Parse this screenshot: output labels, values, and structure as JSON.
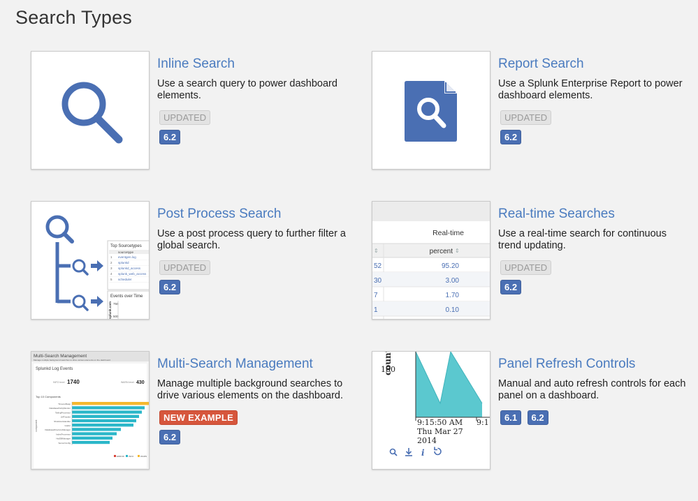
{
  "page": {
    "title": "Search Types"
  },
  "colors": {
    "accent": "#4a7bbf",
    "version_badge": "#4a6fb3",
    "new_badge": "#d6563c",
    "chart_fill": "#5bc8cf"
  },
  "cards": [
    {
      "title": "Inline Search",
      "description": "Use a search query to power dashboard elements.",
      "status_badge": "UPDATED",
      "versions": [
        "6.2"
      ],
      "thumbnail_icon": "magnifier-icon"
    },
    {
      "title": "Report Search",
      "description": "Use a Splunk Enterprise Report to power dashboard elements.",
      "status_badge": "UPDATED",
      "versions": [
        "6.2"
      ],
      "thumbnail_icon": "report-document-icon"
    },
    {
      "title": "Post Process Search",
      "description": "Use a post process query to further filter a global search.",
      "status_badge": "UPDATED",
      "versions": [
        "6.2"
      ],
      "thumbnail": {
        "panel_title": "Top Sourcetypes",
        "column": "sourcetype",
        "rows": [
          [
            "1",
            "eventgen.log"
          ],
          [
            "2",
            "splunkd"
          ],
          [
            "3",
            "splunkd_access"
          ],
          [
            "4",
            "splunk_web_access"
          ],
          [
            "5",
            "scheduler"
          ]
        ],
        "panel2_title": "Events over Time",
        "axis_values": [
          "750",
          "500"
        ],
        "axis_label": "splunk.com"
      }
    },
    {
      "title": "Real-time Searches",
      "description": "Use a real-time search for continuous trend updating.",
      "status_badge": "UPDATED",
      "versions": [
        "6.2"
      ],
      "thumbnail": {
        "header": "Real-time",
        "column": "percent",
        "rows": [
          {
            "left": "52",
            "percent": "95.20"
          },
          {
            "left": "30",
            "percent": "3.00"
          },
          {
            "left": "7",
            "percent": "1.70"
          },
          {
            "left": "1",
            "percent": "0.10"
          }
        ]
      }
    },
    {
      "title": "Multi-Search Management",
      "description": "Manage multiple background searches to drive various elements on the dashboard.",
      "status_badge": "NEW EXAMPLE",
      "versions": [
        "6.2"
      ],
      "thumbnail": {
        "app_title": "Multi-Search Management",
        "app_subtitle": "Manage multiple background searches to drive various elements on the dashboard",
        "section_title": "Splunkd Log Events",
        "stat1_label": "INFO level",
        "stat1_value": "1740",
        "stat2_label": "WARN level",
        "stat2_value": "430",
        "chart_title": "Top 10 Components",
        "y_axis_label": "component",
        "components": [
          "TimeoutReap",
          "DatabaseParityMonitor",
          "TailingProcessor",
          "LMTracker",
          "ShutdownHandler",
          "loader",
          "DatabaseDirectoryManager",
          "IndexProcessor",
          "HotDBManager",
          "ServerConfig"
        ],
        "legend": [
          "ERROR",
          "INFO",
          "WARN"
        ]
      }
    },
    {
      "title": "Panel Refresh Controls",
      "description": "Manual and auto refresh controls for each panel on a dashboard.",
      "status_badge": "",
      "versions": [
        "6.1",
        "6.2"
      ],
      "thumbnail": {
        "y_label": "count",
        "y_tick": "100",
        "x_tick1_line1": "9:15:50 AM",
        "x_tick1_line2": "Thu Mar 27",
        "x_tick1_line3": "2014",
        "x_tick2": "9:1",
        "info_symbol": "i"
      }
    }
  ]
}
